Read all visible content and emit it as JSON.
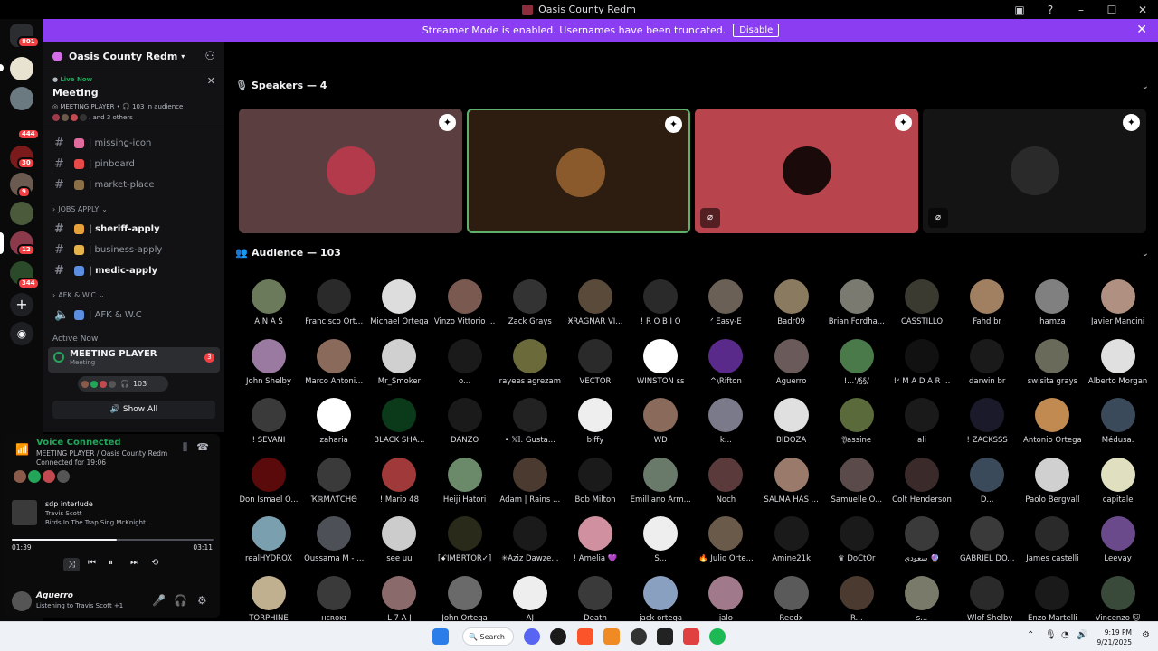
{
  "window": {
    "title": "Oasis County Redm"
  },
  "banner": {
    "text": "Streamer Mode is enabled. Usernames have been truncated.",
    "button": "Disable"
  },
  "guild_badges": [
    "801",
    "444",
    "30",
    "9",
    "12",
    "344"
  ],
  "server": {
    "name": "Oasis County Redm",
    "live": {
      "label": "Live Now",
      "title": "Meeting",
      "stage": "MEETING PLAYER",
      "audience": "103 in audience",
      "others": ". and 3 others"
    },
    "channels": [
      {
        "name": "| missing-icon",
        "color": "#e06c9f",
        "bold": false
      },
      {
        "name": "| pinboard",
        "color": "#e84a4a",
        "bold": false
      },
      {
        "name": "| market-place",
        "color": "#8b6f47",
        "bold": false
      }
    ],
    "jobs_category": "JOBS APPLY",
    "jobs": [
      {
        "name": "| sheriff-apply",
        "color": "#e7a13a",
        "bold": true
      },
      {
        "name": "| business-apply",
        "color": "#e6b34a",
        "bold": false
      },
      {
        "name": "| medic-apply",
        "color": "#5b8de0",
        "bold": true
      }
    ],
    "afk_category": "AFK & W.C",
    "afk_channel": "AFK & W.C",
    "active_now": {
      "label": "Active Now",
      "name": "MEETING PLAYER",
      "sub": "Meeting",
      "badge": "3",
      "count": "103",
      "show_all": "Show All"
    }
  },
  "voice": {
    "status": "Voice Connected",
    "channel": "MEETING PLAYER / Oasis County Redm",
    "connected": "Connected for 19:06"
  },
  "music": {
    "title": "sdp interlude",
    "artist": "Travis Scott",
    "album": "Birds In The Trap Sing McKnight",
    "elapsed": "01:39",
    "total": "03:11",
    "progress": 0.52
  },
  "user": {
    "name": "Aguerro",
    "status": "Listening to Travis Scott +1"
  },
  "stage": {
    "speakers_label": "Speakers — 4",
    "audience_label": "Audience — 103",
    "speakers": [
      {
        "bg": "#5a3e40",
        "avatar": "#b23a4a",
        "muted": false
      },
      {
        "bg": "#2c1d10",
        "avatar": "#8a5a2c",
        "muted": false,
        "active": true
      },
      {
        "bg": "#b8454e",
        "avatar": "#1a0a0a",
        "muted": true
      },
      {
        "bg": "#141414",
        "avatar": "#222222",
        "muted": true
      }
    ]
  },
  "audience": [
    {
      "name": "A N A S",
      "c": "#6a7a5a"
    },
    {
      "name": "Francisco Ort...",
      "c": "#2a2a2a"
    },
    {
      "name": "Michael Ortega",
      "c": "#dddddd"
    },
    {
      "name": "Vinzo Vittorio ...",
      "c": "#7a5a50"
    },
    {
      "name": "Zack Grays",
      "c": "#333333"
    },
    {
      "name": "ӾRAGNAR VI...",
      "c": "#5a4a3a"
    },
    {
      "name": "! R O B I O",
      "c": "#2a2a2a"
    },
    {
      "name": "ᐟ Easy-E",
      "c": "#6a6055"
    },
    {
      "name": "Badr09",
      "c": "#8a7a60"
    },
    {
      "name": "Brian Fordha...",
      "c": "#7a7a70"
    },
    {
      "name": "CASSTILLO",
      "c": "#3a3a30"
    },
    {
      "name": "Fahd br",
      "c": "#a08060"
    },
    {
      "name": "hamza",
      "c": "#808080"
    },
    {
      "name": "Javier Mancini",
      "c": "#b09080"
    },
    {
      "name": "John Shelby",
      "c": "#9a7aa0"
    },
    {
      "name": "Marco Antoni...",
      "c": "#8a6a5a"
    },
    {
      "name": "Mr_Smoker",
      "c": "#d0d0d0"
    },
    {
      "name": "o...",
      "c": "#1a1a1a"
    },
    {
      "name": "rayees agrezam",
      "c": "#6a6a3a"
    },
    {
      "name": "VECTOR",
      "c": "#2a2a2a"
    },
    {
      "name": "WINSTON ɛs",
      "c": "#ffffff"
    },
    {
      "name": "^\\Rifton",
      "c": "#5a2a8a"
    },
    {
      "name": "Aguerro",
      "c": "#6a5a5a"
    },
    {
      "name": "!...'/§§/",
      "c": "#4a7a4a"
    },
    {
      "name": "!ᵛ M A D A R ...",
      "c": "#111111"
    },
    {
      "name": "darwin br",
      "c": "#1a1a1a"
    },
    {
      "name": "swisita grays",
      "c": "#6a6a5a"
    },
    {
      "name": "Alberto Morgan",
      "c": "#e0e0e0"
    },
    {
      "name": "! SEVANI",
      "c": "#3a3a3a"
    },
    {
      "name": "zaharia",
      "c": "#ffffff"
    },
    {
      "name": "BLACK SHA...",
      "c": "#0a3a1a"
    },
    {
      "name": "DANZO",
      "c": "#1a1a1a"
    },
    {
      "name": "• 𝕏𝕀. Gusta...",
      "c": "#222222"
    },
    {
      "name": "biffy",
      "c": "#eeeeee"
    },
    {
      "name": "WD",
      "c": "#8a6a5a"
    },
    {
      "name": "k...",
      "c": "#7a7a8a"
    },
    {
      "name": "BIDOZA",
      "c": "#e0e0e0"
    },
    {
      "name": "𝔜assine",
      "c": "#5a6a3a"
    },
    {
      "name": "ali",
      "c": "#1a1a1a"
    },
    {
      "name": "! ZACKSSS",
      "c": "#1a1a2a"
    },
    {
      "name": "Antonio Ortega",
      "c": "#c08a50"
    },
    {
      "name": "Médusa.",
      "c": "#3a4a5a"
    },
    {
      "name": "Don Ismael O...",
      "c": "#5a0a0a"
    },
    {
      "name": "ҠℝΜΛƬСНΘ",
      "c": "#3a3a3a"
    },
    {
      "name": "! Mario 48",
      "c": "#a03a3a"
    },
    {
      "name": "Heiji Hatori",
      "c": "#6a8a6a"
    },
    {
      "name": "Adam | Rains ...",
      "c": "#4a3a30"
    },
    {
      "name": "Bob Milton",
      "c": "#1a1a1a"
    },
    {
      "name": "Emilliano Arm...",
      "c": "#6a7a6a"
    },
    {
      "name": "Noch",
      "c": "#5a3a3a"
    },
    {
      "name": "SALMA HAS ...",
      "c": "#9a7a6a"
    },
    {
      "name": "Samuelle O...",
      "c": "#5a4a4a"
    },
    {
      "name": "Colt Henderson",
      "c": "#3a2a2a"
    },
    {
      "name": "D...",
      "c": "#3a4a5a"
    },
    {
      "name": "Paolo Bergvall",
      "c": "#d0d0d0"
    },
    {
      "name": "capitale",
      "c": "#e0e0c0"
    },
    {
      "name": "realHYDROX",
      "c": "#7aa0b0"
    },
    {
      "name": "Oussama M - ...",
      "c": "#4e5058"
    },
    {
      "name": "see uu",
      "c": "#cccccc"
    },
    {
      "name": "[ꗃIMBRTOR✓]",
      "c": "#2a2a1a"
    },
    {
      "name": "✳Aziz Dawze...",
      "c": "#1a1a1a"
    },
    {
      "name": "! Amelia 💜",
      "c": "#d090a0"
    },
    {
      "name": "S...",
      "c": "#eeeeee"
    },
    {
      "name": "🔥 Julio Orte...",
      "c": "#6a5a4a"
    },
    {
      "name": "Amine21k",
      "c": "#1a1a1a"
    },
    {
      "name": "♛ DoCtOr",
      "c": "#1a1a1a"
    },
    {
      "name": "سعودي 🔮",
      "c": "#3a3a3a"
    },
    {
      "name": "GABRIEL DO...",
      "c": "#3a3a3a"
    },
    {
      "name": "James castelli",
      "c": "#2a2a2a"
    },
    {
      "name": "Leevay",
      "c": "#6a4a8a"
    },
    {
      "name": "TORPHINE",
      "c": "#c0b090"
    },
    {
      "name": "ʜᴇʀᴏᴋɪ",
      "c": "#3a3a3a"
    },
    {
      "name": "L 7 A J",
      "c": "#8a6a6a"
    },
    {
      "name": "John Ortega",
      "c": "#6a6a6a"
    },
    {
      "name": "AJ",
      "c": "#eeeeee"
    },
    {
      "name": "Death",
      "c": "#3a3a3a"
    },
    {
      "name": "jack ortega",
      "c": "#8aa0c0"
    },
    {
      "name": "jalo",
      "c": "#a07a8a"
    },
    {
      "name": "Reedx",
      "c": "#5a5a5a"
    },
    {
      "name": "R...",
      "c": "#4a3a30"
    },
    {
      "name": "s...",
      "c": "#7a7a6a"
    },
    {
      "name": "! Wlof Shelby",
      "c": "#2a2a2a"
    },
    {
      "name": "Enzo Martelli",
      "c": "#1a1a1a"
    },
    {
      "name": "Vincenzo 🐱",
      "c": "#3a4a3a"
    }
  ],
  "taskbar": {
    "search": "Search",
    "time": "9:19 PM",
    "date": "9/21/2025"
  }
}
